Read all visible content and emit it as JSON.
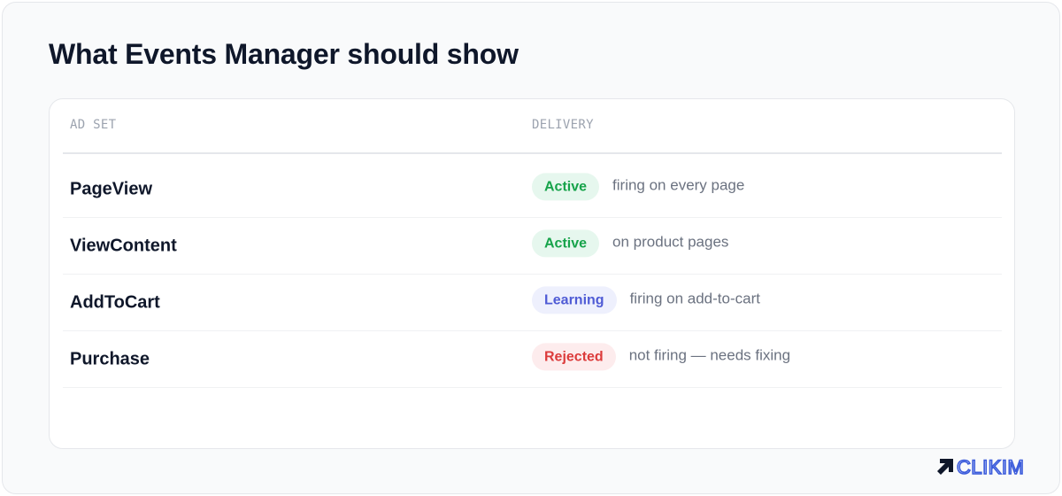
{
  "header": {
    "title": "What Events Manager should show"
  },
  "table": {
    "columns": [
      "AD SET",
      "DELIVERY"
    ],
    "rows": [
      {
        "name": "PageView",
        "status": "Active",
        "status_type": "active",
        "note": "firing on every page"
      },
      {
        "name": "ViewContent",
        "status": "Active",
        "status_type": "active",
        "note": "on product pages"
      },
      {
        "name": "AddToCart",
        "status": "Learning",
        "status_type": "learning",
        "note": "firing on add-to-cart"
      },
      {
        "name": "Purchase",
        "status": "Rejected",
        "status_type": "rejected",
        "note": "not firing — needs fixing"
      }
    ]
  },
  "colors": {
    "active": "#16a34a",
    "learning": "#4f5bd5",
    "rejected": "#dc3b3b",
    "brand": "#3b5bdb"
  },
  "brand": {
    "name": "CLIKIM",
    "icon": "arrow-up-left-icon"
  }
}
